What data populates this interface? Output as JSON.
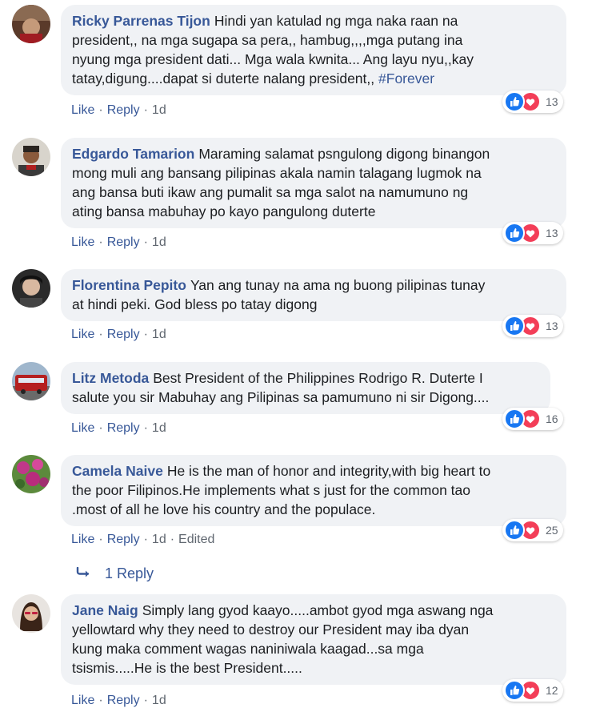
{
  "comments": [
    {
      "author": "Ricky Parrenas Tijon",
      "lines": [
        "Hindi yan katulad ng mga naka raan na",
        "president,, na mga sugapa sa pera,, hambug,,,,mga putang ina",
        "nyung mga president dati... Mga wala kwnita... Ang layu nyu,,kay",
        "tatay,digung....dapat si duterte nalang president,,"
      ],
      "hashtag": "#Forever",
      "like_label": "Like",
      "reply_label": "Reply",
      "time": "1d",
      "edited": "",
      "reaction_count": "13"
    },
    {
      "author": "Edgardo Tamarion",
      "lines": [
        "Maraming salamat psngulong digong binangon",
        "mong muli ang bansang pilipinas akala namin talagang lugmok na",
        "ang bansa buti ikaw ang pumalit sa mga salot na namumuno ng",
        "ating bansa mabuhay po kayo pangulong duterte"
      ],
      "hashtag": "",
      "like_label": "Like",
      "reply_label": "Reply",
      "time": "1d",
      "edited": "",
      "reaction_count": "13"
    },
    {
      "author": "Florentina Pepito",
      "lines": [
        "Yan ang tunay na ama ng buong pilipinas tunay",
        "at hindi peki. God bless po tatay digong"
      ],
      "hashtag": "",
      "like_label": "Like",
      "reply_label": "Reply",
      "time": "1d",
      "edited": "",
      "reaction_count": "13"
    },
    {
      "author": "Litz Metoda",
      "lines": [
        "Best President of the Philippines Rodrigo R. Duterte I",
        "salute you sir Mabuhay ang Pilipinas sa pamumuno ni sir Digong...."
      ],
      "hashtag": "",
      "like_label": "Like",
      "reply_label": "Reply",
      "time": "1d",
      "edited": "",
      "reaction_count": "16"
    },
    {
      "author": "Camela Naive",
      "lines": [
        "He is the man of honor and integrity,with big heart to",
        "the poor Filipinos.He implements what s just for the common tao",
        ".most of all he love his country and the populace."
      ],
      "hashtag": "",
      "like_label": "Like",
      "reply_label": "Reply",
      "time": "1d",
      "edited": "Edited",
      "reaction_count": "25"
    },
    {
      "author": "Jane Naig",
      "lines": [
        "Simply lang gyod kaayo.....ambot gyod mga aswang nga",
        "yellowtard why they need to destroy our President may iba dyan",
        "kung maka comment wagas naniniwala kaagad...sa mga",
        "tsismis.....He is the best President....."
      ],
      "hashtag": "",
      "like_label": "Like",
      "reply_label": "Reply",
      "time": "1d",
      "edited": "",
      "reaction_count": "12"
    }
  ],
  "replies_link": {
    "label": "1 Reply"
  },
  "colors": {
    "author": "#385898",
    "bubble": "#f0f2f5",
    "like": "#1877f2",
    "love": "#f33e58",
    "meta": "#606770"
  },
  "icons": {
    "reaction_like": "like-reaction-icon",
    "reaction_love": "love-reaction-icon",
    "reply_arrow": "reply-arrow-icon"
  }
}
